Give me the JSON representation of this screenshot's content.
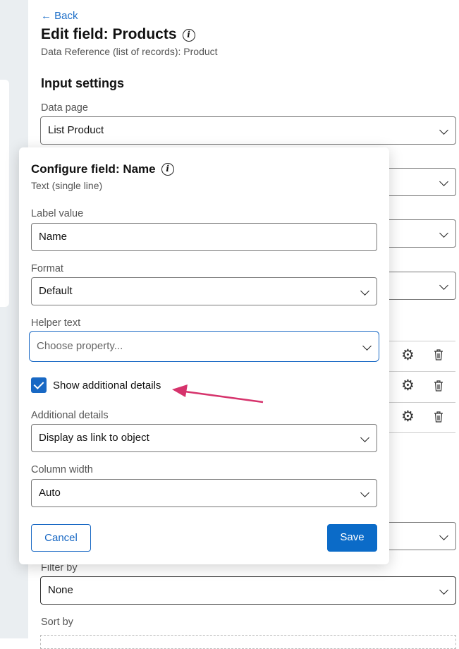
{
  "header": {
    "back_label": "Back",
    "title": "Edit field: Products",
    "subtitle": "Data Reference (list of records): Product"
  },
  "input_settings": {
    "heading": "Input settings",
    "data_page_label": "Data page",
    "data_page_value": "List Product",
    "filter_label": "Filter by",
    "filter_value": "None",
    "sort_label": "Sort by"
  },
  "dialog": {
    "title": "Configure field: Name",
    "subtitle": "Text (single line)",
    "label_value_label": "Label value",
    "label_value": "Name",
    "format_label": "Format",
    "format_value": "Default",
    "helper_label": "Helper text",
    "helper_placeholder": "Choose property...",
    "show_details_label": "Show additional details",
    "show_details_checked": true,
    "additional_label": "Additional details",
    "additional_value": "Display as link to object",
    "width_label": "Column width",
    "width_value": "Auto",
    "cancel_label": "Cancel",
    "save_label": "Save"
  },
  "colors": {
    "accent": "#1868c4",
    "annotation_arrow": "#d6336c"
  }
}
